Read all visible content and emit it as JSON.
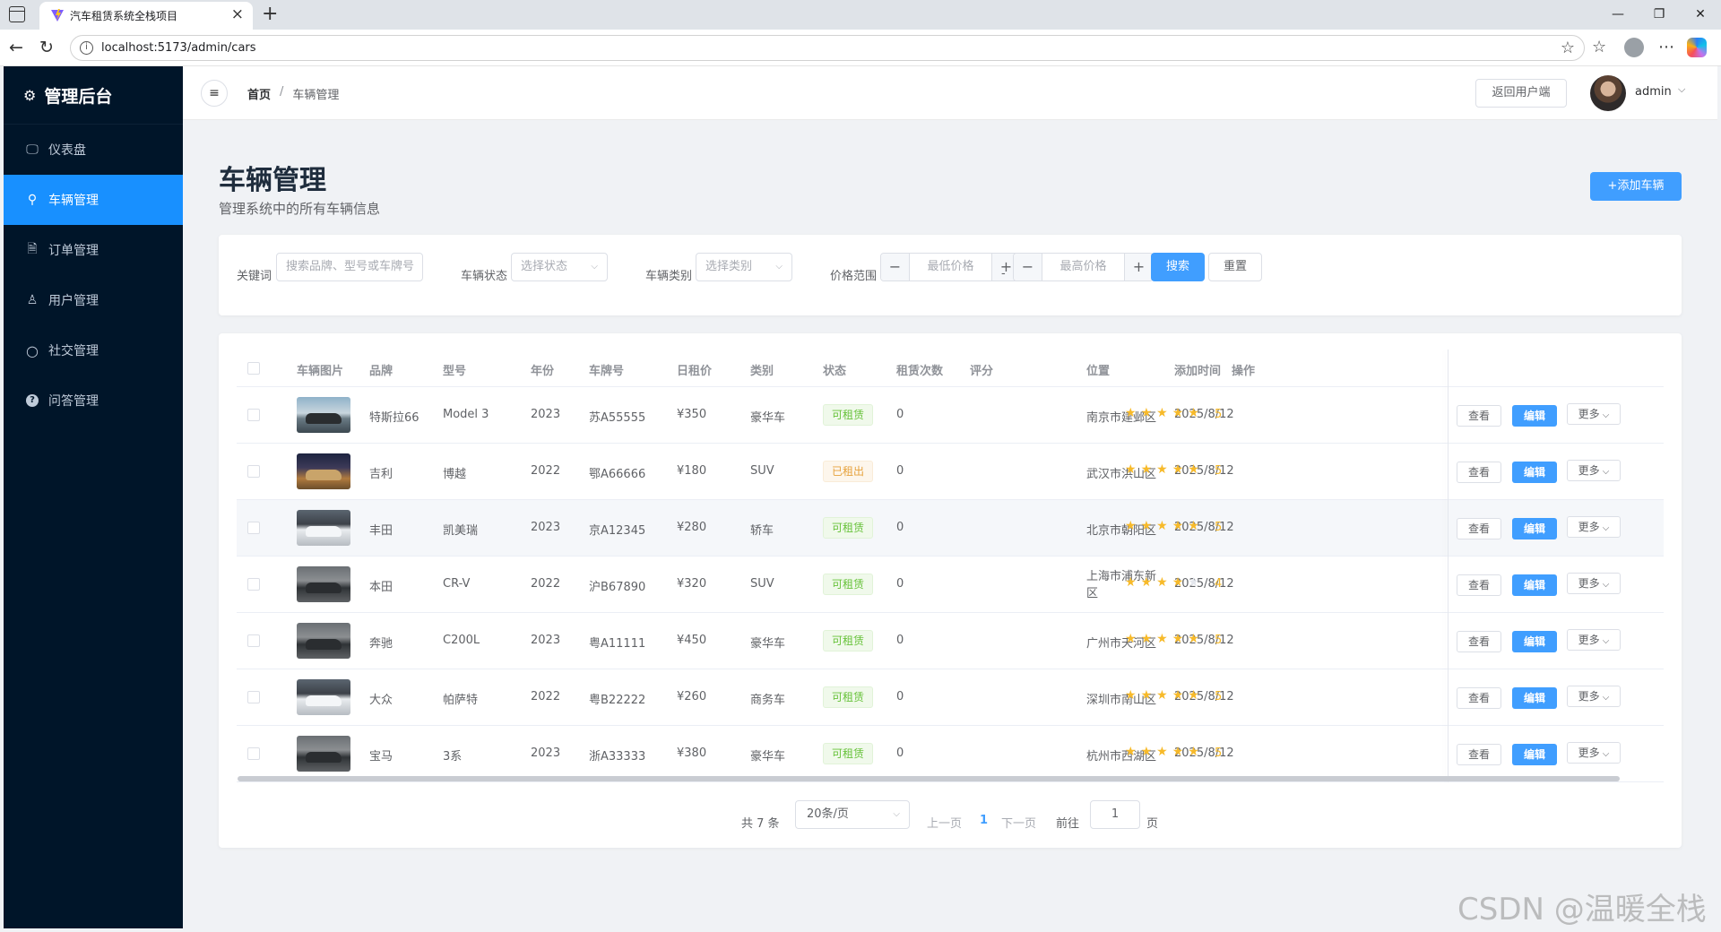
{
  "browser": {
    "tab_title": "汽车租赁系统全栈项目",
    "url": "localhost:5173/admin/cars"
  },
  "sidebar": {
    "title": "管理后台",
    "items": [
      {
        "label": "仪表盘",
        "icon": "monitor-icon"
      },
      {
        "label": "车辆管理",
        "icon": "bicycle-icon",
        "active": true
      },
      {
        "label": "订单管理",
        "icon": "document-icon"
      },
      {
        "label": "用户管理",
        "icon": "user-icon"
      },
      {
        "label": "社交管理",
        "icon": "chat-bubble-icon"
      },
      {
        "label": "问答管理",
        "icon": "question-circle-icon"
      }
    ]
  },
  "header": {
    "breadcrumb_home": "首页",
    "breadcrumb_sep": "/",
    "breadcrumb_current": "车辆管理",
    "back_button": "返回用户端",
    "username": "admin"
  },
  "page": {
    "title": "车辆管理",
    "subtitle": "管理系统中的所有车辆信息",
    "add_button": "+添加车辆"
  },
  "search": {
    "keyword_label": "关键词",
    "keyword_placeholder": "搜索品牌、型号或车牌号",
    "status_label": "车辆状态",
    "status_placeholder": "选择状态",
    "category_label": "车辆类别",
    "category_placeholder": "选择类别",
    "price_label": "价格范围",
    "min_price_placeholder": "最低价格",
    "max_price_placeholder": "最高价格",
    "range_sep": "-",
    "search_button": "搜索",
    "reset_button": "重置"
  },
  "table": {
    "columns": [
      "车辆图片",
      "品牌",
      "型号",
      "年份",
      "车牌号",
      "日租价",
      "类别",
      "状态",
      "租赁次数",
      "评分",
      "位置",
      "添加时间",
      "操作"
    ],
    "actions": {
      "view": "查看",
      "edit": "编辑",
      "more": "更多"
    },
    "rows": [
      {
        "brand": "特斯拉66",
        "model": "Model 3",
        "year": "2023",
        "plate": "苏A55555",
        "price": "¥350",
        "category": "豪华车",
        "status": "可租赁",
        "status_type": "ok",
        "rentals": "0",
        "rating": 5,
        "rating_text": "5",
        "location": "南京市建邺区",
        "added": "2025/8/12",
        "thumb": "sunset"
      },
      {
        "brand": "吉利",
        "model": "博越",
        "year": "2022",
        "plate": "鄂A66666",
        "price": "¥180",
        "category": "SUV",
        "status": "已租出",
        "status_type": "warn",
        "rentals": "0",
        "rating": 5,
        "rating_text": "5",
        "location": "武汉市洪山区",
        "added": "2025/8/12",
        "thumb": "night"
      },
      {
        "brand": "丰田",
        "model": "凯美瑞",
        "year": "2023",
        "plate": "京A12345",
        "price": "¥280",
        "category": "轿车",
        "status": "可租赁",
        "status_type": "ok",
        "rentals": "0",
        "rating": 5,
        "rating_text": "5",
        "location": "北京市朝阳区",
        "added": "2025/8/12",
        "thumb": "white"
      },
      {
        "brand": "本田",
        "model": "CR-V",
        "year": "2022",
        "plate": "沪B67890",
        "price": "¥320",
        "category": "SUV",
        "status": "可租赁",
        "status_type": "ok",
        "rentals": "0",
        "rating": 4,
        "rating_text": "4",
        "location": "上海市浦东新区",
        "added": "2025/8/12",
        "thumb": "dark"
      },
      {
        "brand": "奔驰",
        "model": "C200L",
        "year": "2023",
        "plate": "粤A11111",
        "price": "¥450",
        "category": "豪华车",
        "status": "可租赁",
        "status_type": "ok",
        "rentals": "0",
        "rating": 5,
        "rating_text": "5",
        "location": "广州市天河区",
        "added": "2025/8/12",
        "thumb": "dark"
      },
      {
        "brand": "大众",
        "model": "帕萨特",
        "year": "2022",
        "plate": "粤B22222",
        "price": "¥260",
        "category": "商务车",
        "status": "可租赁",
        "status_type": "ok",
        "rentals": "0",
        "rating": 5,
        "rating_text": "5",
        "location": "深圳市南山区",
        "added": "2025/8/12",
        "thumb": "white"
      },
      {
        "brand": "宝马",
        "model": "3系",
        "year": "2023",
        "plate": "浙A33333",
        "price": "¥380",
        "category": "豪华车",
        "status": "可租赁",
        "status_type": "ok",
        "rentals": "0",
        "rating": 5,
        "rating_text": "5",
        "location": "杭州市西湖区",
        "added": "2025/8/12",
        "thumb": "dark"
      }
    ]
  },
  "pagination": {
    "total": "共 7 条",
    "page_size": "20条/页",
    "prev": "上一页",
    "current": "1",
    "next": "下一页",
    "goto": "前往",
    "goto_value": "1",
    "page_suffix": "页"
  },
  "watermark": "CSDN @温暖全栈",
  "colors": {
    "sidebar_bg": "#001529",
    "primary": "#409eff",
    "success": "#67c23a",
    "warning": "#e6a23c",
    "star": "#f7ba2a"
  }
}
